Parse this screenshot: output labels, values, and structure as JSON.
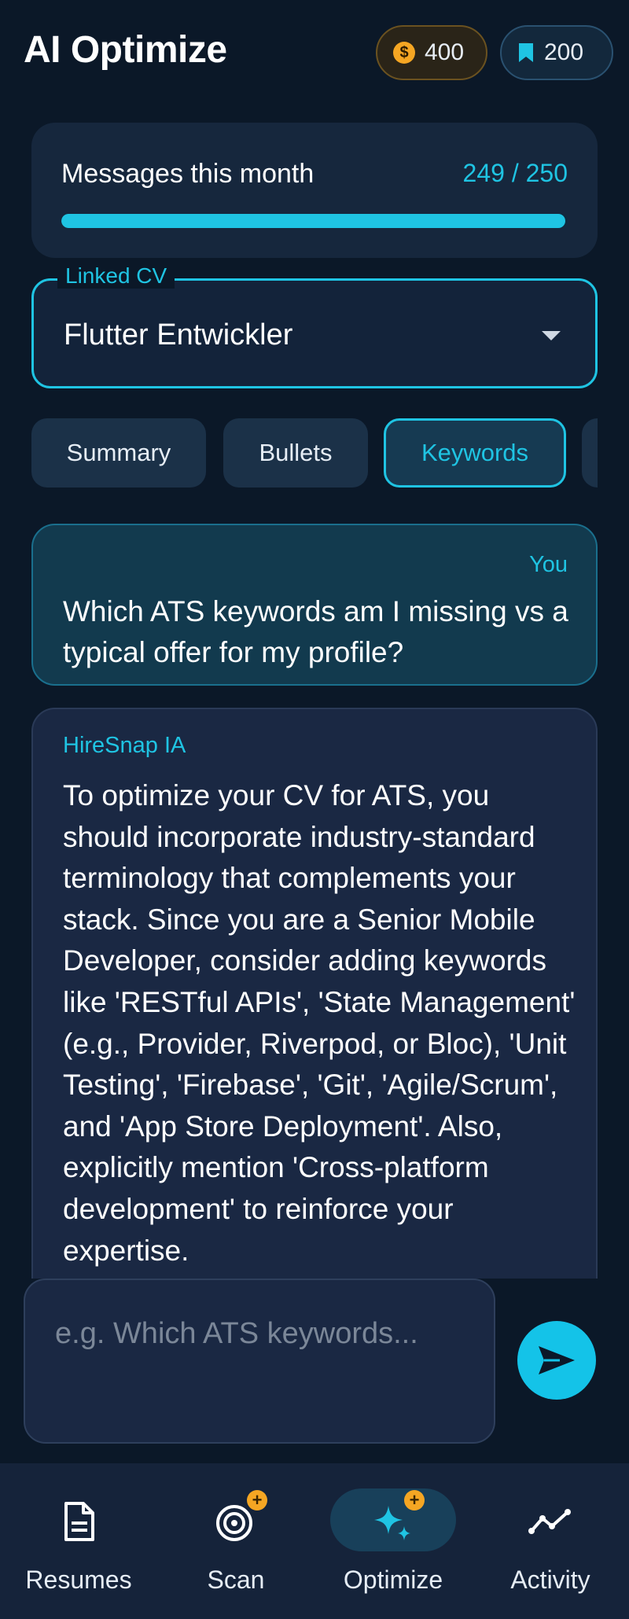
{
  "header": {
    "title": "AI Optimize",
    "coins": "400",
    "bookmarks": "200"
  },
  "quota": {
    "label": "Messages this month",
    "value": "249 / 250",
    "progress": 0.996
  },
  "linked_cv": {
    "legend": "Linked CV",
    "value": "Flutter Entwickler"
  },
  "chips": [
    {
      "label": "Summary"
    },
    {
      "label": "Bullets"
    },
    {
      "label": "Keywords",
      "active": true
    }
  ],
  "messages": {
    "user": {
      "author": "You",
      "text": "Which ATS keywords am I missing vs a typical offer for my profile?"
    },
    "ai": {
      "author": "HireSnap IA",
      "text": "To optimize your CV for ATS, you should incorporate industry-standard terminology that complements your stack. Since you are a Senior Mobile Developer, consider adding keywords like 'RESTful APIs', 'State Management' (e.g., Provider, Riverpod, or Bloc), 'Unit Testing', 'Firebase', 'Git', 'Agile/Scrum', and 'App Store Deployment'. Also, explicitly mention 'Cross-platform development' to reinforce your expertise."
    }
  },
  "composer": {
    "placeholder": "e.g. Which ATS keywords..."
  },
  "nav": [
    {
      "label": "Resumes",
      "icon": "document-icon"
    },
    {
      "label": "Scan",
      "icon": "scan-target-icon"
    },
    {
      "label": "Optimize",
      "icon": "sparkle-icon",
      "active": true
    },
    {
      "label": "Activity",
      "icon": "activity-chart-icon"
    }
  ],
  "colors": {
    "accent": "#1fc4e3",
    "background": "#0b1828",
    "badge": "#f5a623"
  }
}
